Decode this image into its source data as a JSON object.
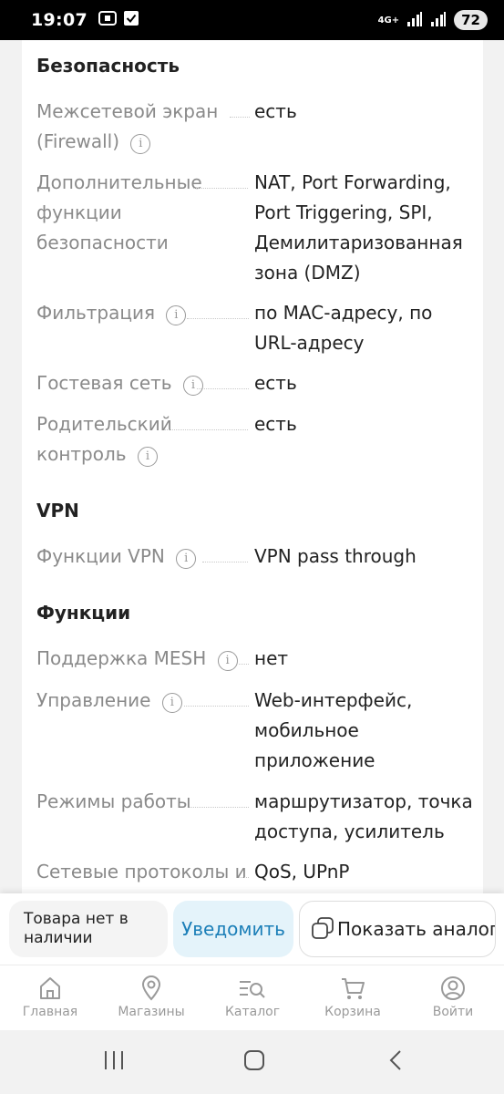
{
  "status_bar": {
    "time": "19:07",
    "network": "4G+",
    "battery": "72"
  },
  "sections": {
    "security": {
      "title": "Безопасность",
      "rows": [
        {
          "label": "Межсетевой экран (Firewall)",
          "value": "есть"
        },
        {
          "label": "Дополнительные функции безопасности",
          "value": "NAT, Port Forwarding, Port Triggering, SPI, Демилитаризованная зона (DMZ)"
        },
        {
          "label": "Фильтрация",
          "value": "по MAC-адресу, по URL-адресу"
        },
        {
          "label": "Гостевая сеть",
          "value": "есть"
        },
        {
          "label": "Родительский контроль",
          "value": "есть"
        }
      ]
    },
    "vpn": {
      "title": "VPN",
      "rows": [
        {
          "label": "Функции VPN",
          "value": "VPN pass through"
        }
      ]
    },
    "functions": {
      "title": "Функции",
      "rows": [
        {
          "label": "Поддержка MESH",
          "value": "нет"
        },
        {
          "label": "Управление",
          "value": "Web-интерфейс, мобильное приложение"
        },
        {
          "label": "Режимы работы",
          "value": "маршрутизатор, точка доступа, усилитель"
        },
        {
          "label": "Сетевые протоколы и",
          "value": "QoS, UPnP"
        }
      ]
    }
  },
  "action_bar": {
    "stock_status": "Товара нет в наличии",
    "notify_label": "Уведомить",
    "analogs_label": "Показать аналоги"
  },
  "tabbar": {
    "items": [
      {
        "label": "Главная",
        "icon": "home-icon"
      },
      {
        "label": "Магазины",
        "icon": "location-pin-icon"
      },
      {
        "label": "Каталог",
        "icon": "catalog-search-icon"
      },
      {
        "label": "Корзина",
        "icon": "cart-icon"
      },
      {
        "label": "Войти",
        "icon": "profile-icon"
      }
    ]
  },
  "colors": {
    "accent": "#1c7fb8",
    "notify_bg": "#e4f3fa",
    "label_gray": "#8a8a8a"
  }
}
